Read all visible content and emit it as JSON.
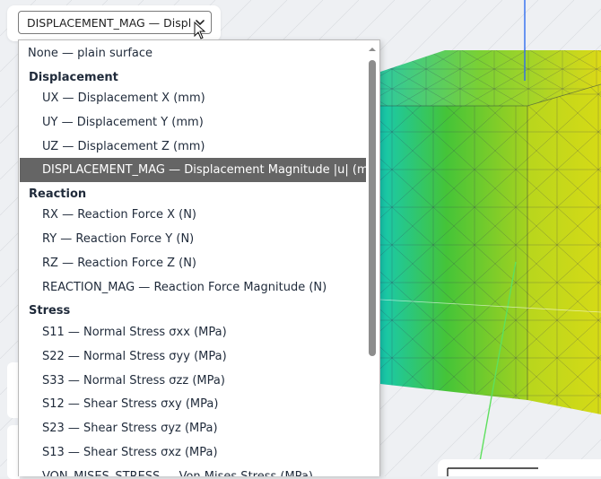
{
  "select": {
    "value": "DISPLACEMENT_MAG — Displa",
    "chevron": "chevron-down-icon"
  },
  "dropdown": {
    "top_option": "None — plain surface",
    "groups": [
      {
        "label": "Displacement",
        "options": [
          "UX — Displacement X (mm)",
          "UY — Displacement Y (mm)",
          "UZ — Displacement Z (mm)",
          "DISPLACEMENT_MAG — Displacement Magnitude |u| (mm)"
        ]
      },
      {
        "label": "Reaction",
        "options": [
          "RX — Reaction Force X (N)",
          "RY — Reaction Force Y (N)",
          "RZ — Reaction Force Z (N)",
          "REACTION_MAG — Reaction Force Magnitude (N)"
        ]
      },
      {
        "label": "Stress",
        "options": [
          "S11 — Normal Stress σxx (MPa)",
          "S22 — Normal Stress σyy (MPa)",
          "S33 — Normal Stress σzz (MPa)",
          "S12 — Shear Stress σxy (MPa)",
          "S23 — Shear Stress σyz (MPa)",
          "S13 — Shear Stress σxz (MPa)",
          "VON_MISES_STRESS — Von Mises Stress (MPa)"
        ]
      }
    ],
    "selected": "DISPLACEMENT_MAG — Displacement Magnitude |u| (mm)"
  },
  "colors": {
    "selected_bg": "#656565",
    "mesh_cyan": "#17c9b0",
    "mesh_green": "#45c438",
    "mesh_yellow": "#d8dc17",
    "axis_blue": "#2f6cf0",
    "axis_green": "#5ee05e"
  }
}
